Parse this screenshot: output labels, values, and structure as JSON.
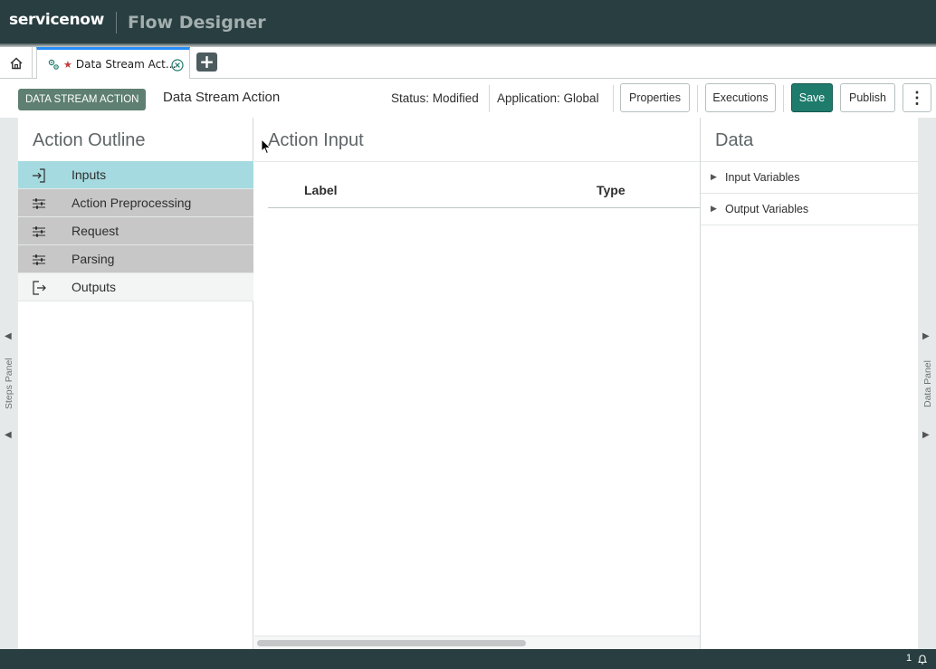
{
  "header": {
    "brand": "servicenow",
    "product": "Flow Designer"
  },
  "tabs": {
    "home_icon": "home-icon",
    "open_tab": {
      "label": "Data Stream Act...",
      "modified_marker": "★",
      "icon": "gear-icon",
      "close_icon": "close-circle-icon"
    },
    "add_tab_label": "+"
  },
  "action_bar": {
    "type_badge": "DATA STREAM ACTION",
    "title": "Data Stream Action",
    "status": "Status: Modified",
    "application": "Application: Global",
    "properties_label": "Properties",
    "executions_label": "Executions",
    "save_label": "Save",
    "publish_label": "Publish",
    "more_label": "⋮"
  },
  "steps_rail": {
    "label": "Steps Panel",
    "arrow": "◀"
  },
  "data_rail": {
    "label": "Data Panel",
    "arrow": "▶"
  },
  "outline": {
    "title": "Action Outline",
    "items": [
      {
        "label": "Inputs",
        "icon": "input-arrow-icon",
        "state": "selected"
      },
      {
        "label": "Action Preprocessing",
        "icon": "sliders-icon",
        "state": "step"
      },
      {
        "label": "Request",
        "icon": "sliders-icon",
        "state": "step"
      },
      {
        "label": "Parsing",
        "icon": "sliders-icon",
        "state": "step"
      },
      {
        "label": "Outputs",
        "icon": "output-arrow-icon",
        "state": "plain"
      }
    ]
  },
  "center": {
    "title": "Action Input",
    "columns": [
      "Label",
      "Type"
    ]
  },
  "data_panel": {
    "title": "Data",
    "items": [
      {
        "label": "Input Variables"
      },
      {
        "label": "Output Variables"
      }
    ]
  },
  "footer": {
    "notification_count": "1",
    "bell_icon": "bell-icon"
  },
  "colors": {
    "header_bg": "#293e40",
    "save_button": "#1f7b6c",
    "badge_bg": "#5e7f72",
    "selected_item": "#a5dbe0",
    "step_item": "#c7c7c7",
    "tab_accent": "#278efc"
  }
}
